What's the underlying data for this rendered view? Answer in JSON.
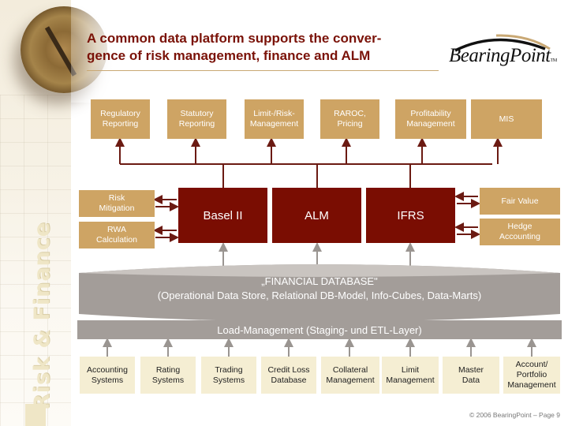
{
  "slide": {
    "title": "A common data platform supports the convergence of risk management, finance and ALM",
    "title_line1": "A common data platform supports the conver-",
    "title_line2": "gence of risk management, finance and ALM",
    "section_label": "Risk & Finance",
    "logo": "BearingPoint",
    "logo_tm": "TM",
    "footer": "© 2006 BearingPoint – Page 9"
  },
  "colors": {
    "title": "#7a1208",
    "tan_box": "#cea464",
    "core_box": "#7a0d02",
    "database": "#a39d99",
    "source_box": "#f5eed3",
    "connector_dark": "#6b1a12",
    "connector_grey": "#9a9591"
  },
  "applications": [
    {
      "label": "Regulatory\nReporting",
      "l1": "Regulatory",
      "l2": "Reporting"
    },
    {
      "label": "Statutory\nReporting",
      "l1": "Statutory",
      "l2": "Reporting"
    },
    {
      "label": "Limit-/Risk-\nManagement",
      "l1": "Limit-/Risk-",
      "l2": "Management"
    },
    {
      "label": "RAROC,\nPricing",
      "l1": "RAROC,",
      "l2": "Pricing"
    },
    {
      "label": "Profitability\nManagement",
      "l1": "Profitability",
      "l2": "Management"
    },
    {
      "label": "MIS",
      "l1": "MIS",
      "l2": ""
    }
  ],
  "core_modules": [
    {
      "label": "Basel II"
    },
    {
      "label": "ALM"
    },
    {
      "label": "IFRS"
    }
  ],
  "basel_side": [
    {
      "l1": "Risk",
      "l2": "Mitigation"
    },
    {
      "l1": "RWA",
      "l2": "Calculation"
    }
  ],
  "ifrs_side": [
    {
      "l1": "Fair Value",
      "l2": ""
    },
    {
      "l1": "Hedge",
      "l2": "Accounting"
    }
  ],
  "database": {
    "line1": "„FINANCIAL DATABASE\"",
    "line2": "(Operational Data Store, Relational DB-Model, Info-Cubes, Data-Marts)"
  },
  "load_layer": {
    "label": "Load-Management (Staging- und ETL-Layer)"
  },
  "sources": [
    {
      "l1": "Accounting",
      "l2": "Systems",
      "l3": ""
    },
    {
      "l1": "Rating",
      "l2": "Systems",
      "l3": ""
    },
    {
      "l1": "Trading",
      "l2": "Systems",
      "l3": ""
    },
    {
      "l1": "Credit Loss",
      "l2": "Database",
      "l3": ""
    },
    {
      "l1": "Collateral",
      "l2": "Management",
      "l3": ""
    },
    {
      "l1": "Limit",
      "l2": "Management",
      "l3": ""
    },
    {
      "l1": "Master",
      "l2": "Data",
      "l3": ""
    },
    {
      "l1": "Account/",
      "l2": "Portfolio",
      "l3": "Management"
    }
  ]
}
